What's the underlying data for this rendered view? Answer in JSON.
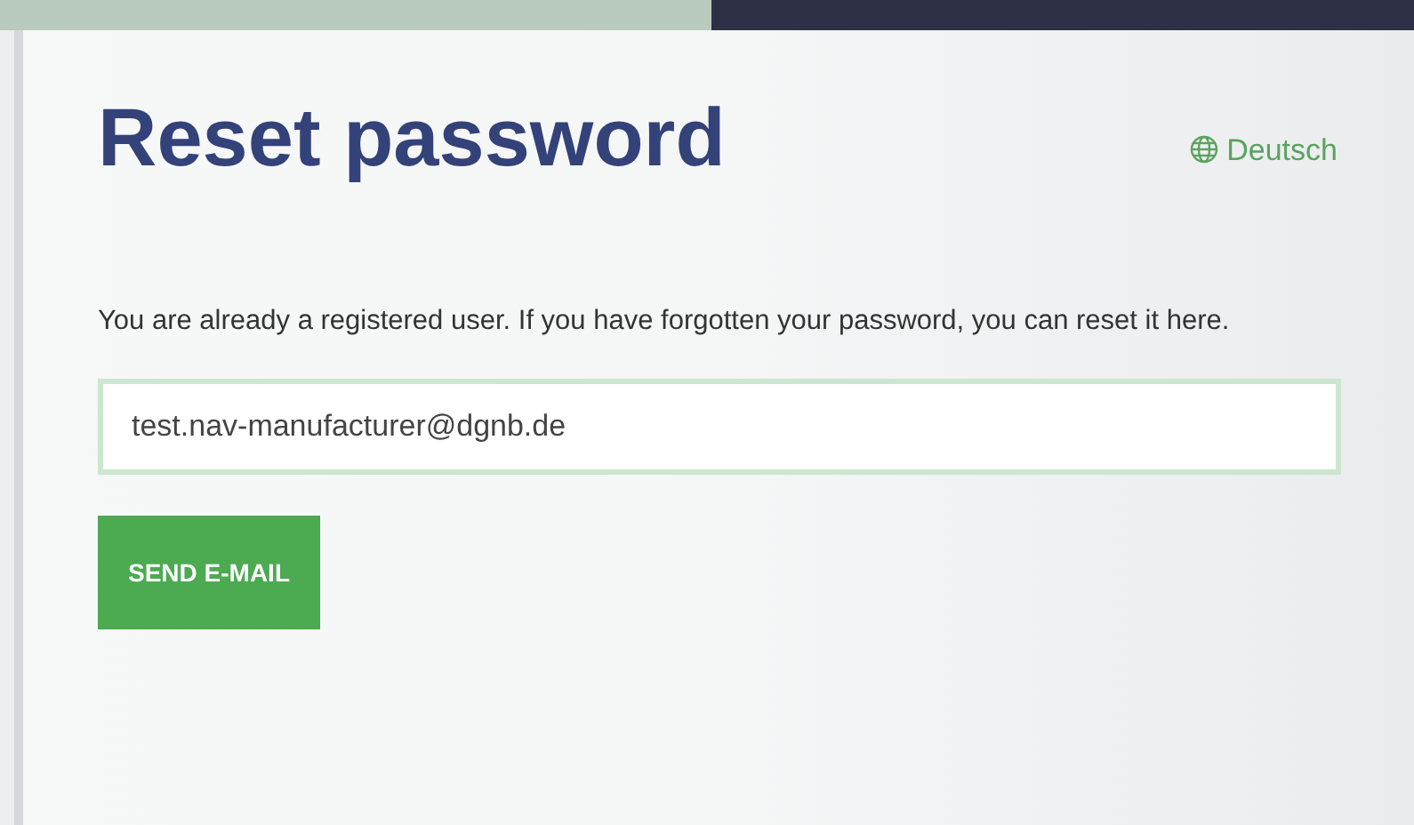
{
  "title": "Reset password",
  "language_link": {
    "label": "Deutsch"
  },
  "description": "You are already a registered user. If you have forgotten your password, you can reset it here.",
  "email_field": {
    "value": "test.nav-manufacturer@dgnb.de"
  },
  "submit_button": {
    "label": "SEND E-MAIL"
  }
}
